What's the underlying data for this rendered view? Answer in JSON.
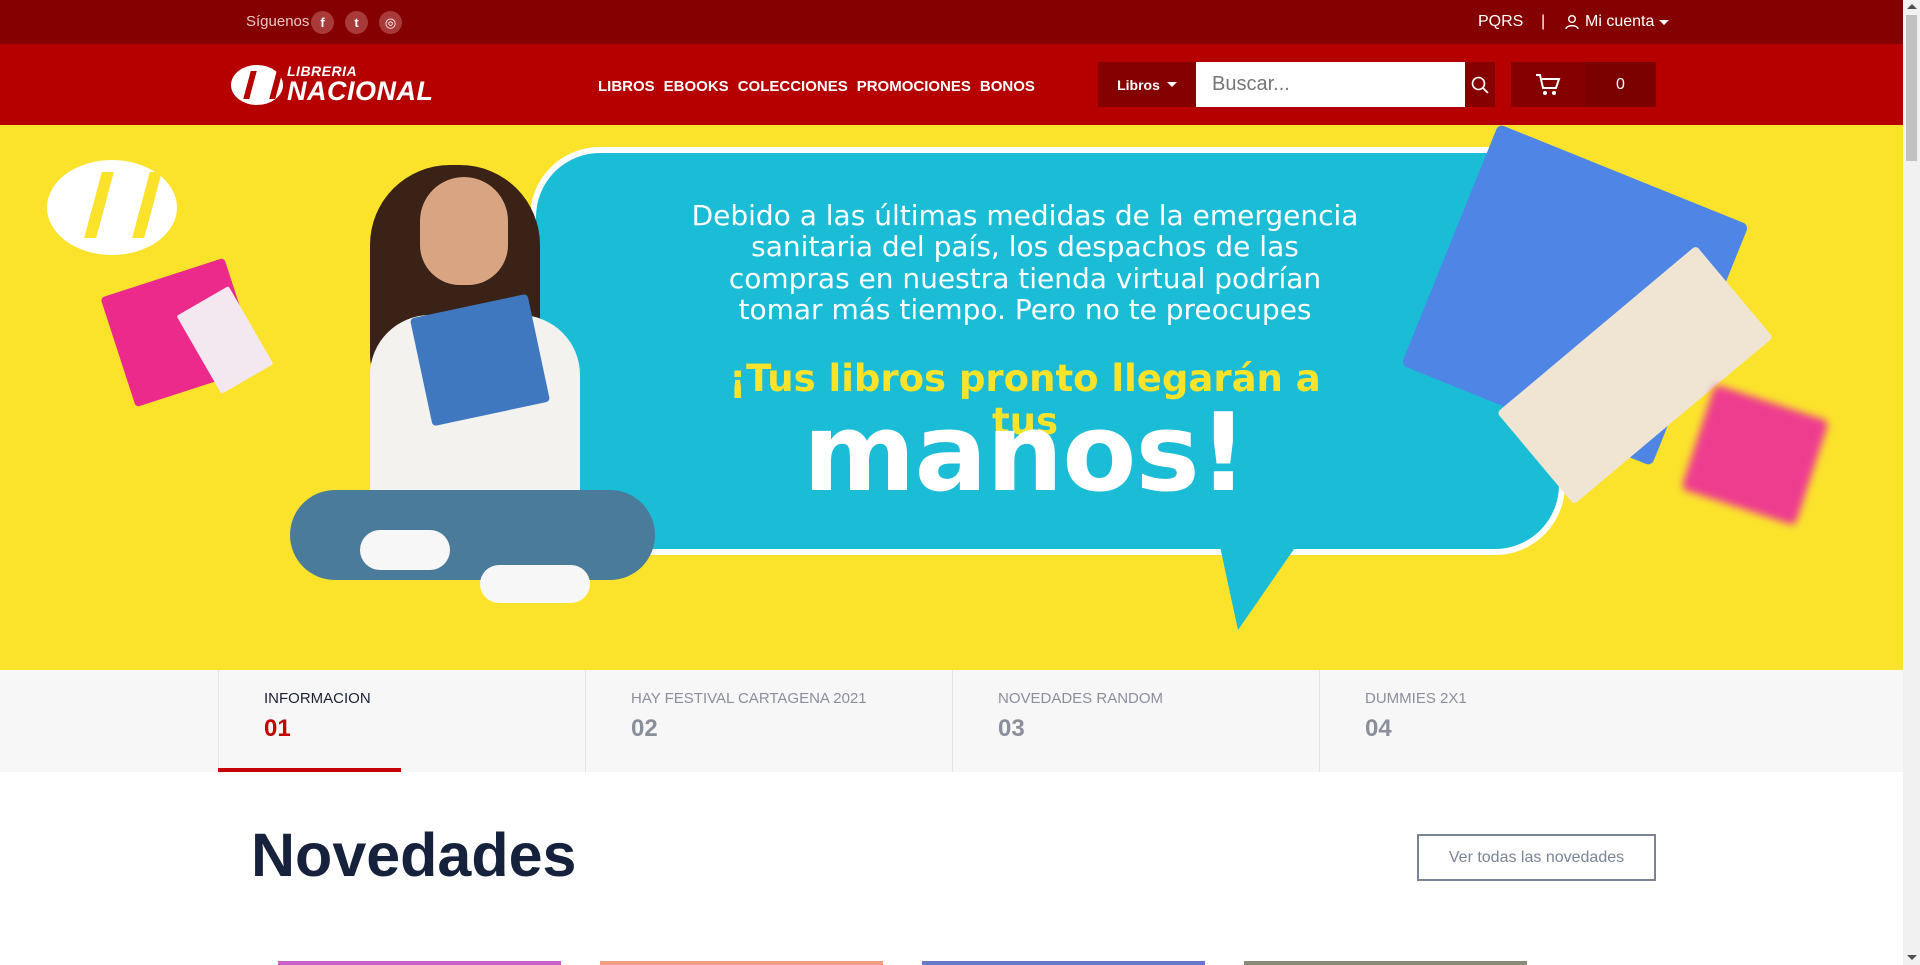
{
  "topbar": {
    "follow_label": "Síguenos",
    "social": [
      {
        "icon": "facebook-icon",
        "glyph": "f"
      },
      {
        "icon": "twitter-icon",
        "glyph": "t"
      },
      {
        "icon": "instagram-icon",
        "glyph": "◎"
      }
    ],
    "pqrs": "PQRS",
    "separator": "|",
    "account": "Mi cuenta"
  },
  "header": {
    "logo_small": "LIBRERIA",
    "logo_big": "NACIONAL",
    "nav": [
      "LIBROS",
      "EBOOKS",
      "COLECCIONES",
      "PROMOCIONES",
      "BONOS"
    ],
    "category": "Libros",
    "search_placeholder": "Buscar...",
    "cart_count": "0"
  },
  "hero": {
    "message": "Debido a las últimas medidas de la emergencia sanitaria del país, los despachos de las compras en nuestra tienda virtual podrían tomar más tiempo. Pero no te preocupes",
    "headline": "¡Tus libros pronto llegarán a tus",
    "big_word": "manos!"
  },
  "tabs": [
    {
      "title": "INFORMACION",
      "num": "01"
    },
    {
      "title": "HAY FESTIVAL CARTAGENA 2021",
      "num": "02"
    },
    {
      "title": "NOVEDADES RANDOM",
      "num": "03"
    },
    {
      "title": "DUMMIES 2X1",
      "num": "04"
    }
  ],
  "section": {
    "title": "Novedades",
    "see_all": "Ver todas las novedades"
  },
  "colors": {
    "topbar": "#850000",
    "header": "#b60000",
    "hero_bg": "#fbe32c",
    "bubble": "#1abcd6",
    "accent": "#c40000"
  },
  "covers": [
    "#c860c8",
    "#f0a080",
    "#6878c8",
    "#8a8a78"
  ]
}
